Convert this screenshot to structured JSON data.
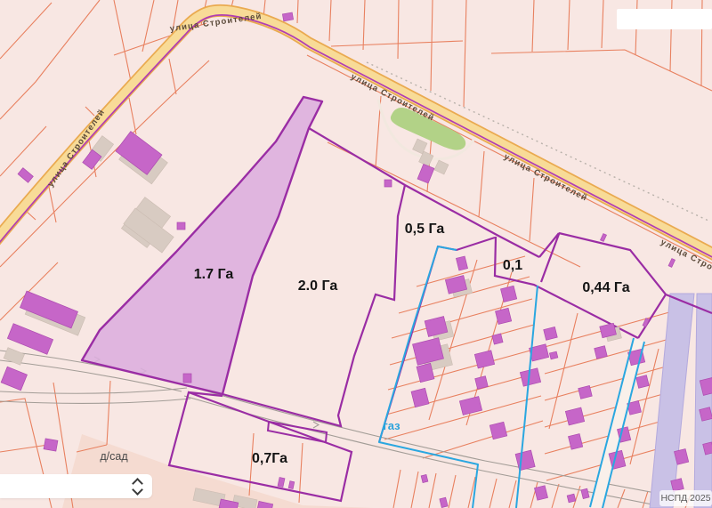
{
  "map": {
    "attribution": "НСПД 2025",
    "streets": {
      "label": "улица Строителей"
    },
    "parcels": [
      {
        "area": "1.7 Га"
      },
      {
        "area": "2.0 Га"
      },
      {
        "area": "0,5 Га"
      },
      {
        "area": "0,1"
      },
      {
        "area": "0,44 Га"
      },
      {
        "area": "0,7Га"
      }
    ],
    "pois": {
      "kindergarten": "д/сад",
      "gas_pipeline": "газ"
    },
    "colors": {
      "background": "#f8e7e3",
      "cadastral_line": "#e8805f",
      "parcel_outline": "#9a2da4",
      "parcel_highlight_fill": "#dcaede",
      "road_fill": "#f8db97",
      "road_edge": "#eaaa50",
      "road_boundary_line": "#b13db3",
      "gas_line": "#2aa7e0",
      "building_fill": "#c666c8",
      "building_gray": "#d8cbc2",
      "lavender_road": "#c9c1e6",
      "green_area": "#b2d287",
      "street_line": "#a39d97"
    }
  },
  "controls": {
    "panel_toggle": {
      "type": "collapse-expand"
    }
  }
}
